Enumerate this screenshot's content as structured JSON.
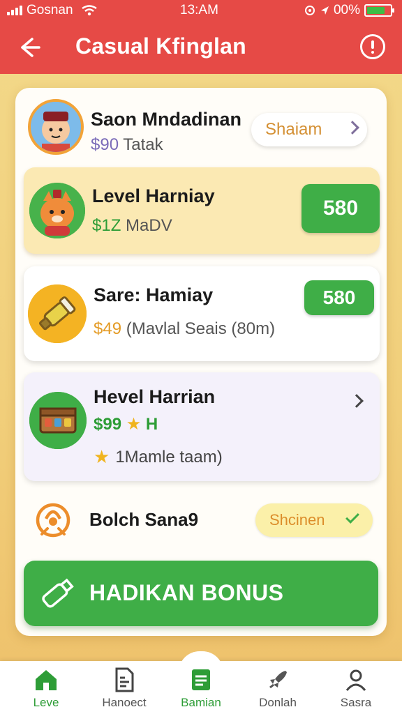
{
  "status_bar": {
    "carrier": "Gosnan",
    "time": "13:AM",
    "battery": "00%"
  },
  "header": {
    "title": "Casual Kfinglan"
  },
  "rows": [
    {
      "name": "Saon Mndadinan",
      "amount": "$90",
      "meta": "Tatak",
      "action": "Shaiam"
    },
    {
      "name": "Level Harniay",
      "amount": "$1Z",
      "meta": "MaDV",
      "action": "580"
    },
    {
      "name": "Sare: Hamiay",
      "amount": "$49",
      "meta": "(Mavlal Seais (80m)",
      "action": "580"
    },
    {
      "name": "Hevel Harrian",
      "amount": "$99",
      "extra": "H",
      "note": "1Mamle taam)"
    },
    {
      "name": "Bolch Sana9",
      "action": "Shcinen"
    }
  ],
  "bonus_button": {
    "label": "HADIKAN BONUS"
  },
  "nav": [
    {
      "label": "Leve",
      "icon": "home-icon"
    },
    {
      "label": "Hanoect",
      "icon": "document-icon"
    },
    {
      "label": "Bamian",
      "icon": "notepad-icon"
    },
    {
      "label": "Donlah",
      "icon": "rocket-icon"
    },
    {
      "label": "Sasra",
      "icon": "profile-icon"
    }
  ],
  "colors": {
    "header": "#e64a46",
    "accent_green": "#3fae47",
    "background": "#f3d98a"
  }
}
